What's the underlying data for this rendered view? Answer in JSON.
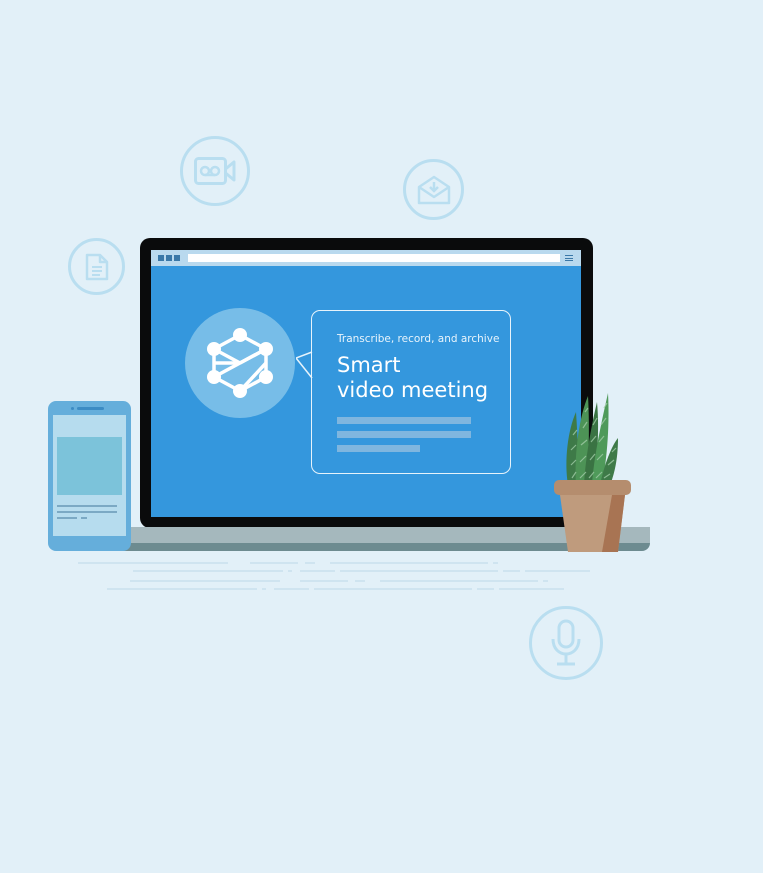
{
  "promo": {
    "subtitle": "Transcribe, record, and archive",
    "title_line1": "Smart",
    "title_line2": "video meeting"
  },
  "icons": {
    "video": "video-camera-icon",
    "mail": "envelope-download-icon",
    "document": "document-icon",
    "microphone": "microphone-icon",
    "logo": "network-logo-icon",
    "plant": "potted-plant"
  },
  "colors": {
    "background": "#e2f0f8",
    "screen": "#3497dd",
    "bezel": "#0a0b0c",
    "icon_outline": "#b9def0",
    "phone": "#65aedb",
    "pot": "#b58d6e"
  }
}
